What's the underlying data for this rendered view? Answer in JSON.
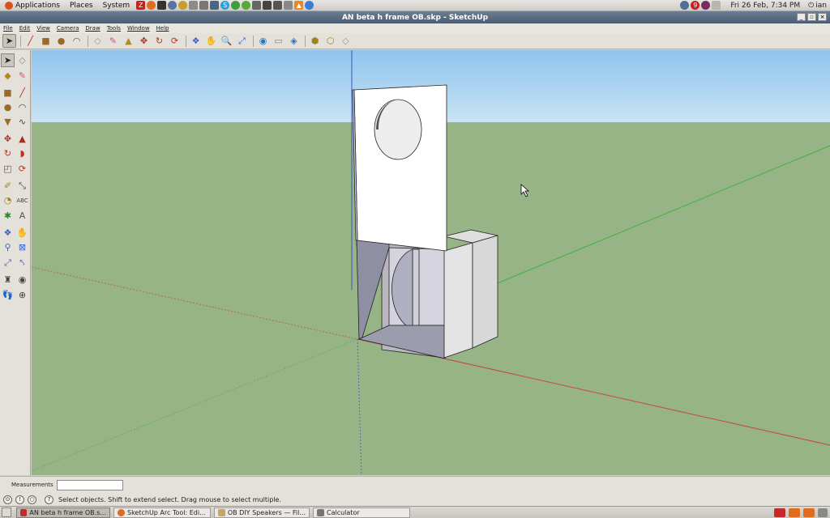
{
  "top_panel": {
    "menus": [
      "Applications",
      "Places",
      "System"
    ],
    "datetime": "Fri 26 Feb,  7:34 PM",
    "user": "ian"
  },
  "window": {
    "title": "AN beta h frame OB.skp - SketchUp"
  },
  "menubar": [
    "File",
    "Edit",
    "View",
    "Camera",
    "Draw",
    "Tools",
    "Window",
    "Help"
  ],
  "measurements": {
    "label": "Measurements",
    "value": ""
  },
  "status": {
    "message": "Select objects. Shift to extend select. Drag mouse to select multiple."
  },
  "taskbar": {
    "tasks": [
      "AN beta h frame OB.s...",
      "SketchUp Arc Tool: Edi...",
      "OB DIY Speakers — Fil...",
      "Calculator"
    ]
  },
  "colors": {
    "sky": "#a9d2f0",
    "ground": "#97b487",
    "axis_red": "#c8463c",
    "axis_green": "#3fb33f",
    "axis_blue": "#3b55c8",
    "title_bar": "#5a6b80"
  },
  "icons": {
    "toolbar": [
      "select-icon",
      "line-icon",
      "rectangle-icon",
      "circle-icon",
      "arc-icon",
      "eraser-icon",
      "paint-icon",
      "pushpull-icon",
      "move-icon",
      "rotate-icon",
      "offset-icon",
      "orbit-icon",
      "pan-icon",
      "zoom-icon",
      "zoom-extents-icon",
      "components-icon",
      "get-models-icon",
      "share-icon",
      "warehouse-icon"
    ],
    "sidebar": [
      "select-icon",
      "component-icon",
      "paint-icon",
      "eraser-icon",
      "rectangle-icon",
      "line-icon",
      "circle-icon",
      "arc-icon",
      "polygon-icon",
      "freehand-icon",
      "move-icon",
      "pushpull-icon",
      "rotate-icon",
      "followme-icon",
      "scale-icon",
      "offset-icon",
      "tape-icon",
      "dimension-icon",
      "protractor-icon",
      "text-icon",
      "axes-icon",
      "3dtext-icon",
      "orbit-icon",
      "pan-icon",
      "zoom-icon",
      "zoom-window-icon",
      "zoom-extents-icon",
      "previous-icon",
      "position-camera-icon",
      "lookaround-icon",
      "walk-icon",
      "section-icon"
    ]
  }
}
